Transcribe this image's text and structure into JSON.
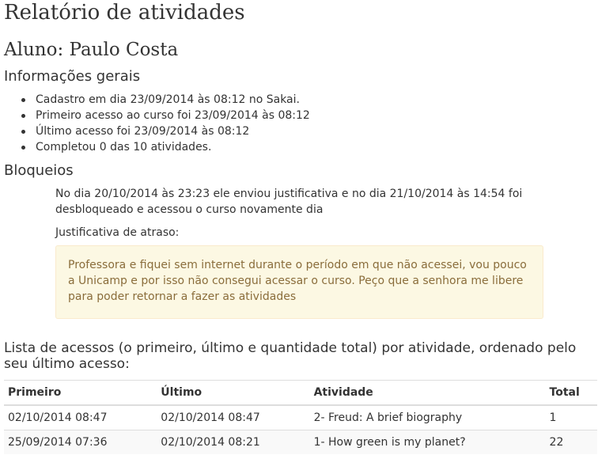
{
  "report": {
    "title": "Relatório de atividades",
    "student": "Aluno: Paulo Costa"
  },
  "general": {
    "heading": "Informações gerais",
    "items": [
      "Cadastro em dia 23/09/2014 às 08:12 no Sakai.",
      "Primeiro acesso ao curso foi 23/09/2014 às 08:12",
      "Último acesso foi 23/09/2014 às 08:12",
      "Completou 0 das 10 atividades."
    ]
  },
  "blocks": {
    "heading": "Bloqueios",
    "line1": "No dia 20/10/2014 às 23:23 ele enviou justificativa e no dia 21/10/2014 às 14:54 foi",
    "line2": "desbloqueado e acessou o curso novamente dia",
    "justification_label": "Justificativa de atraso:",
    "justification_text": "Professora e fiquei sem internet durante o período em que não acessei, vou pouco a Unicamp e por isso não consegui acessar o curso. Peço que a senhora me libere para poder retornar a fazer as atividades"
  },
  "access": {
    "heading": "Lista de acessos (o primeiro, último e quantidade total) por atividade, ordenado pelo seu último acesso:",
    "columns": {
      "first": "Primeiro",
      "last": "Último",
      "activity": "Atividade",
      "total": "Total"
    },
    "rows": [
      {
        "first": "02/10/2014 08:47",
        "last": "02/10/2014 08:47",
        "activity": "2- Freud: A brief biography",
        "total": "1"
      },
      {
        "first": "25/09/2014 07:36",
        "last": "02/10/2014 08:21",
        "activity": "1- How green is my planet?",
        "total": "22"
      }
    ]
  },
  "colors": {
    "text": "#333333",
    "warning_background": "#fcf8e3",
    "warning_border": "#faebcc",
    "warning_text": "#8a6d3b",
    "table_border": "#dddddd",
    "table_stripe": "#f9f9f9"
  }
}
